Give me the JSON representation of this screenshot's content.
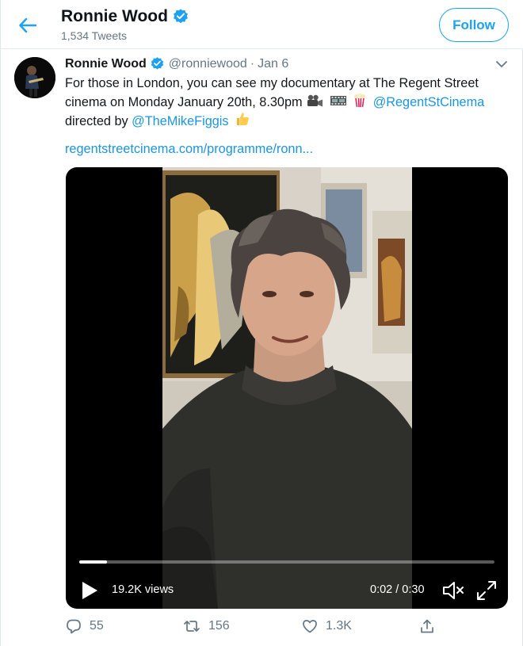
{
  "header": {
    "name": "Ronnie Wood",
    "tweet_count": "1,534 Tweets",
    "follow_label": "Follow"
  },
  "tweet": {
    "name": "Ronnie Wood",
    "handle": "@ronniewood",
    "separator": "·",
    "date": "Jan 6",
    "text_line1": "For those in London, you can see my documentary at The Regent Street",
    "text_line2": "cinema on Monday January 20th, 8.30pm",
    "emojis": [
      "movie-camera-icon",
      "film-frames-icon",
      "popcorn-icon"
    ],
    "mention1": "@RegentStCinema",
    "text_directed": " directed by ",
    "mention2": "@TheMikeFiggis",
    "thumbs_emoji": "thumbs-up-icon",
    "link": "regentstreetcinema.com/programme/ronn..."
  },
  "video": {
    "views": "19.2K views",
    "time": "0:02 / 0:30",
    "progress": 0.066
  },
  "actions": {
    "replies": "55",
    "retweets": "156",
    "likes": "1.3K"
  },
  "colors": {
    "accent": "#1da1f2",
    "link": "#1b95e0",
    "muted": "#657786"
  }
}
